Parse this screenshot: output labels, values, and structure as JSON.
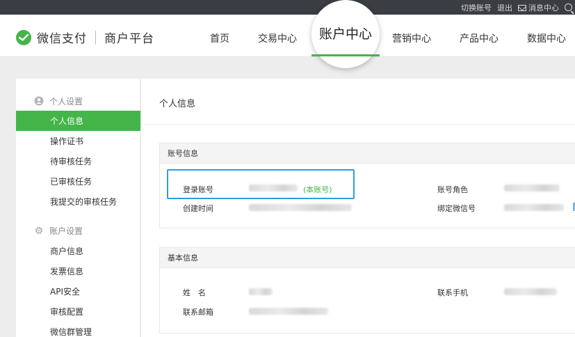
{
  "topbar": {
    "switch_account": "切换账号",
    "logout": "退出",
    "messages": "消息中心",
    "icons": {
      "mail": "mail-icon",
      "search": "search-icon"
    }
  },
  "header": {
    "logo_text": "微信支付",
    "logo_sub": "商户平台",
    "nav": {
      "home": "首页",
      "trade": "交易中心",
      "account": "账户中心",
      "marketing": "营销中心",
      "product": "产品中心",
      "data": "数据中心"
    },
    "accent_color": "#44b549"
  },
  "sidebar": {
    "group1": {
      "label": "个人设置",
      "icon": "user-icon"
    },
    "group1_items": [
      "个人信息",
      "操作证书",
      "待审核任务",
      "已审核任务",
      "我提交的审核任务"
    ],
    "group2": {
      "label": "账户设置",
      "icon": "gear-icon"
    },
    "group2_items": [
      "商户信息",
      "发票信息",
      "API安全",
      "审核配置",
      "微信群管理"
    ],
    "active_item": "个人信息"
  },
  "content": {
    "page_title": "个人信息",
    "account_panel": {
      "title": "账号信息",
      "login_label": "登录账号",
      "self_tag": "(本账号)",
      "created_label": "创建时间",
      "role_label": "账号角色",
      "wechat_label": "绑定微信号"
    },
    "basic_panel": {
      "title": "基本信息",
      "name_label": "姓　名",
      "email_label": "联系邮箱",
      "phone_label": "联系手机"
    },
    "highlight_color": "#2d9ee0"
  }
}
